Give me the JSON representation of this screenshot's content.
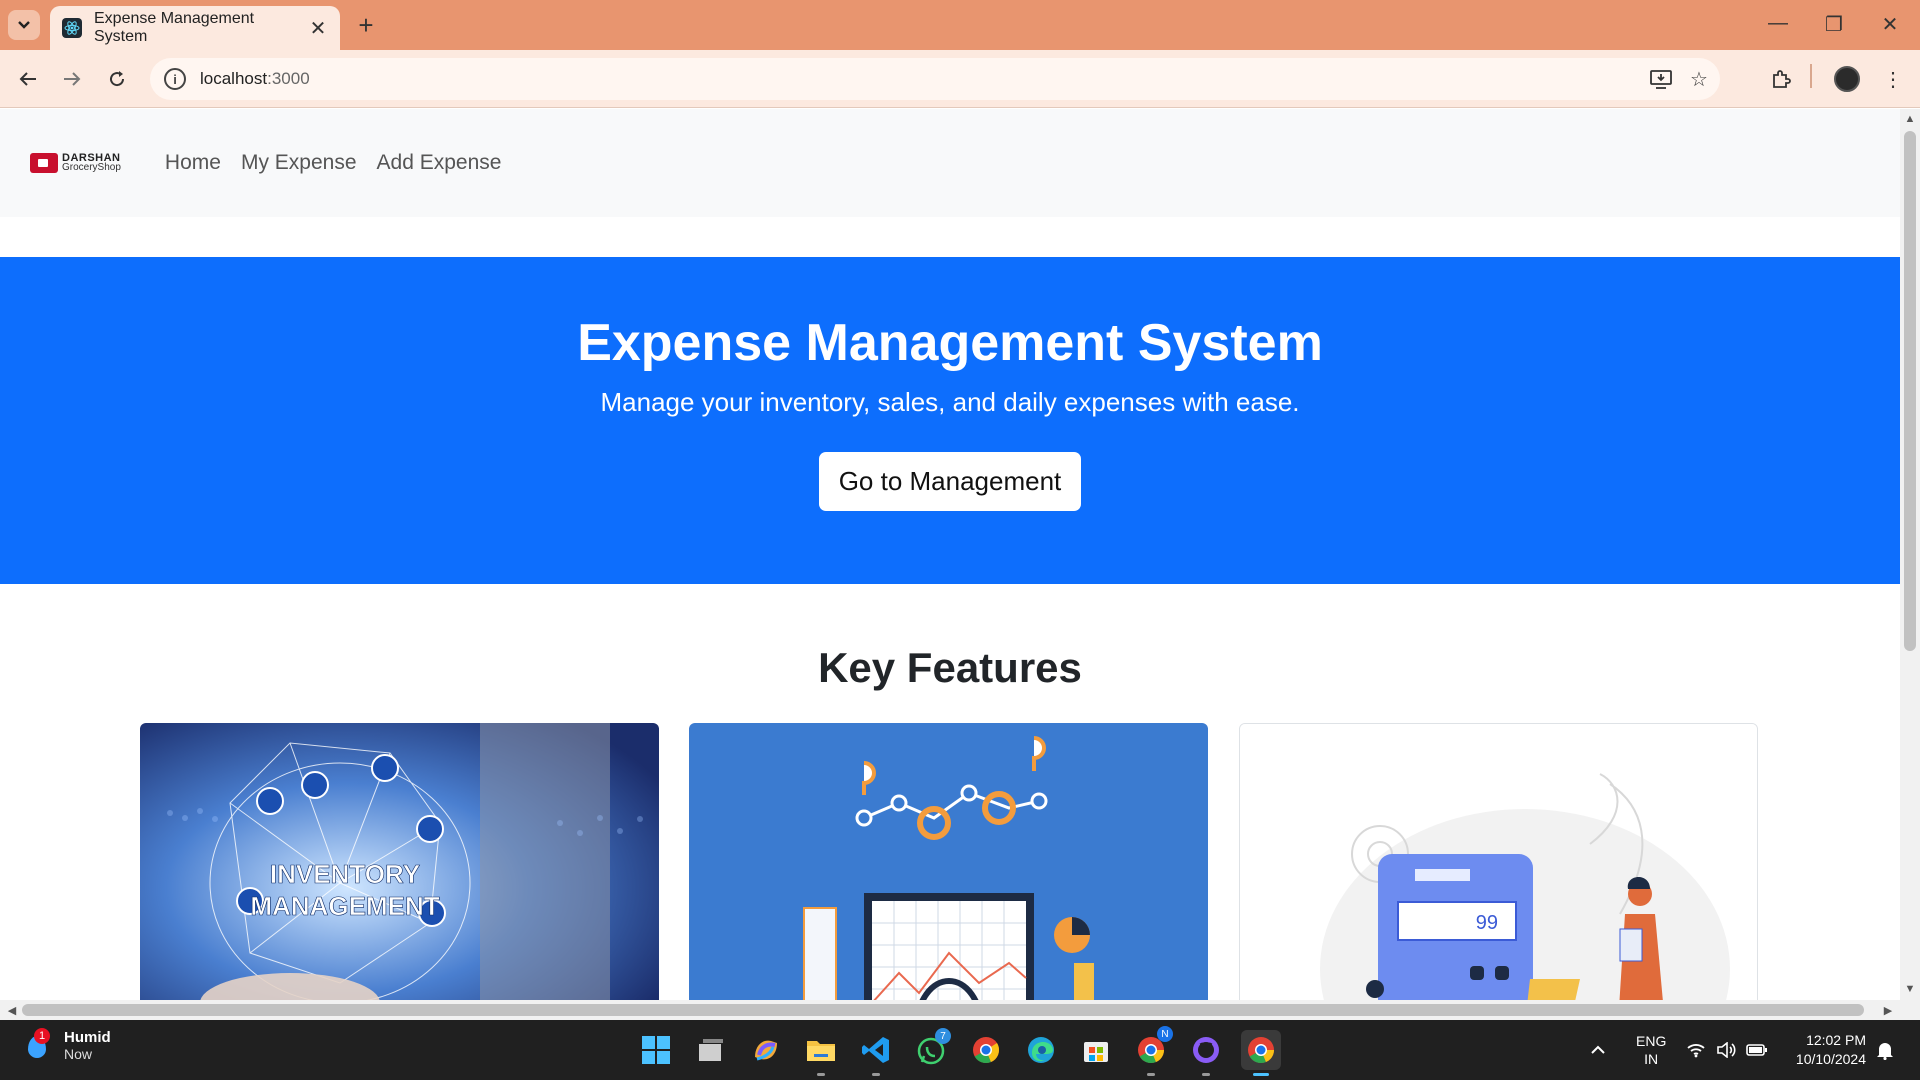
{
  "browser": {
    "tab_title": "Expense Management System",
    "url_host": "localhost",
    "url_port": ":3000"
  },
  "site": {
    "logo_line1": "DARSHAN",
    "logo_line2": "GroceryShop",
    "nav": [
      "Home",
      "My Expense",
      "Add Expense"
    ]
  },
  "hero": {
    "title": "Expense Management System",
    "subtitle": "Manage your inventory, sales, and daily expenses with ease.",
    "cta_label": "Go to Management"
  },
  "features": {
    "title": "Key Features",
    "card1_text_line1": "INVENTORY",
    "card1_text_line2": "MANAGEMENT",
    "card3_display": "99"
  },
  "taskbar": {
    "weather_title": "Humid",
    "weather_sub": "Now",
    "weather_badge": "1",
    "whatsapp_badge": "7",
    "chrome_badge": "N",
    "lang_line1": "ENG",
    "lang_line2": "IN",
    "time": "12:02 PM",
    "date": "10/10/2024"
  },
  "colors": {
    "tabstrip": "#e8956f",
    "hero_bg": "#0d6efd",
    "brand_red": "#c8102e"
  }
}
